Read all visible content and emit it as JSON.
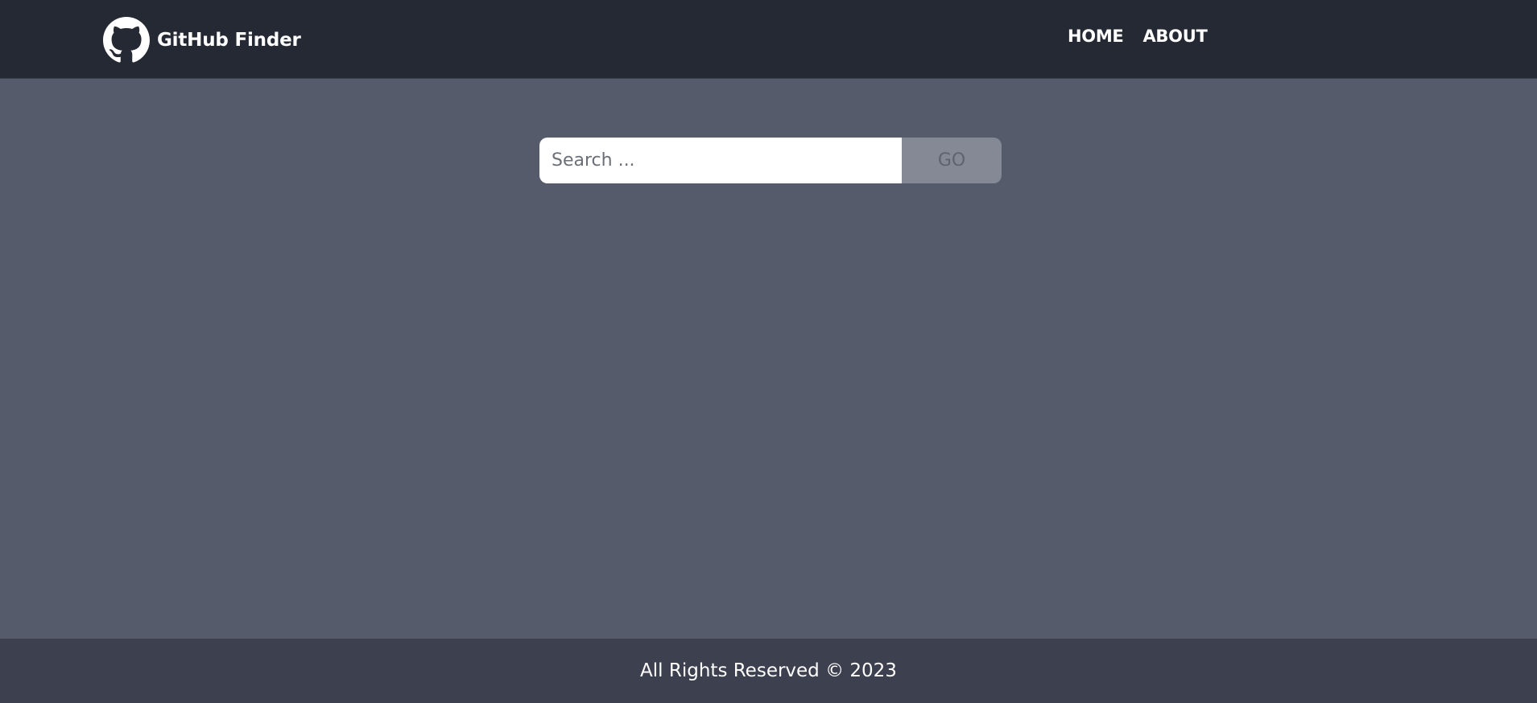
{
  "navbar": {
    "brand_title": "GitHub Finder",
    "logo_icon": "github-icon",
    "links": [
      {
        "label": "HOME"
      },
      {
        "label": "ABOUT"
      }
    ]
  },
  "search": {
    "placeholder": "Search ...",
    "value": "",
    "button_label": "GO"
  },
  "footer": {
    "text": "All Rights Reserved © 2023"
  },
  "colors": {
    "navbar_bg": "#252933",
    "page_bg": "#555b6b",
    "footer_bg": "#3d404f",
    "go_button_bg": "#858996",
    "text_white": "#ffffff"
  }
}
